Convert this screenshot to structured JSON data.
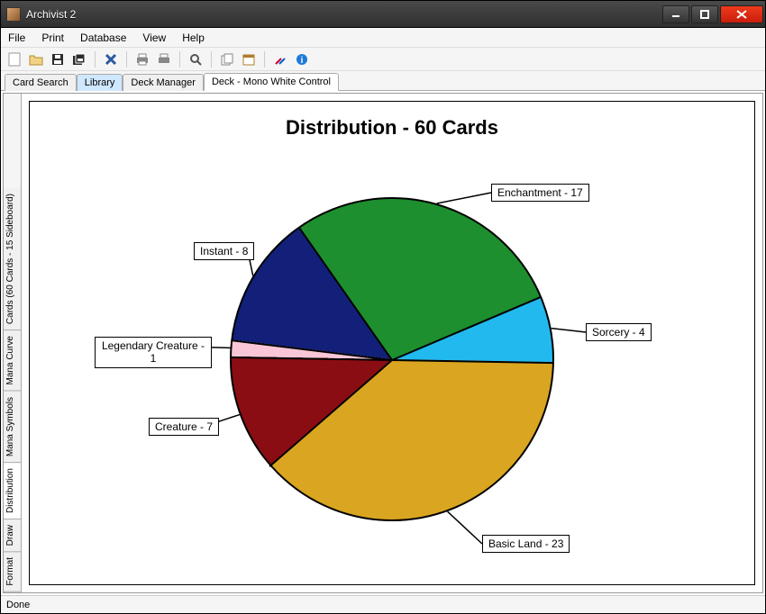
{
  "window": {
    "title": "Archivist 2"
  },
  "menu": {
    "items": [
      "File",
      "Print",
      "Database",
      "View",
      "Help"
    ]
  },
  "tabs": {
    "items": [
      "Card Search",
      "Library",
      "Deck Manager",
      "Deck - Mono White Control"
    ],
    "selected_index": 1,
    "active_index": 3
  },
  "side_tabs": {
    "items": [
      "Format",
      "Draw",
      "Distribution",
      "Mana Symbols",
      "Mana Curve",
      "Cards (60 Cards - 15 Sideboard)"
    ],
    "active_index": 2
  },
  "status": {
    "text": "Done"
  },
  "chart_data": {
    "type": "pie",
    "title": "Distribution - 60 Cards",
    "total": 60,
    "series": [
      {
        "name": "Enchantment",
        "value": 17,
        "color": "#1d8f2e",
        "label": "Enchantment - 17"
      },
      {
        "name": "Sorcery",
        "value": 4,
        "color": "#22b9ef",
        "label": "Sorcery - 4"
      },
      {
        "name": "Basic Land",
        "value": 23,
        "color": "#daa520",
        "label": "Basic Land - 23"
      },
      {
        "name": "Creature",
        "value": 7,
        "color": "#8b0d14",
        "label": "Creature - 7"
      },
      {
        "name": "Legendary Creature",
        "value": 1,
        "color": "#f8c6d6",
        "label": "Legendary Creature - 1"
      },
      {
        "name": "Instant",
        "value": 8,
        "color": "#12207a",
        "label": "Instant - 8"
      }
    ]
  }
}
